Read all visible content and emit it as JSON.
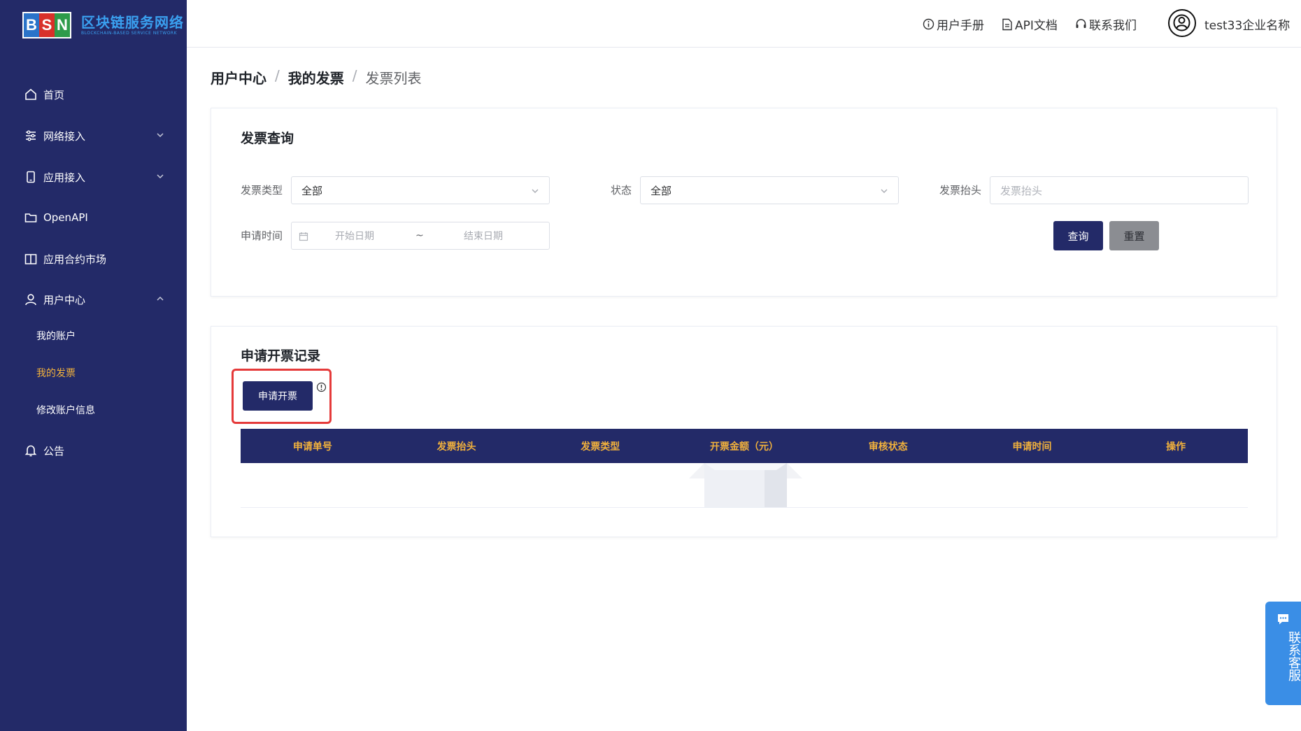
{
  "app": {
    "logo_letters": [
      "B",
      "S",
      "N"
    ],
    "logo_title": "区块链服务网络",
    "logo_subtitle": "BLOCKCHAIN-BASED SERVICE NETWORK"
  },
  "sidebar": {
    "items": [
      {
        "label": "首页",
        "icon": "home-icon"
      },
      {
        "label": "网络接入",
        "icon": "sliders-icon",
        "expandable": true
      },
      {
        "label": "应用接入",
        "icon": "tablet-icon",
        "expandable": true
      },
      {
        "label": "OpenAPI",
        "icon": "folder-icon"
      },
      {
        "label": "应用合约市场",
        "icon": "book-icon"
      },
      {
        "label": "用户中心",
        "icon": "user-icon",
        "expanded": true
      },
      {
        "label": "公告",
        "icon": "bell-icon"
      }
    ],
    "sub_items": [
      {
        "label": "我的账户",
        "active": false
      },
      {
        "label": "我的发票",
        "active": true
      },
      {
        "label": "修改账户信息",
        "active": false
      }
    ]
  },
  "header": {
    "links": [
      "用户手册",
      "API文档",
      "联系我们"
    ],
    "user_name": "test33企业名称"
  },
  "breadcrumb": [
    "用户中心",
    "我的发票",
    "发票列表"
  ],
  "query_card": {
    "title": "发票查询",
    "invoice_type_label": "发票类型",
    "invoice_type_value": "全部",
    "status_label": "状态",
    "status_value": "全部",
    "invoice_title_label": "发票抬头",
    "invoice_title_placeholder": "发票抬头",
    "apply_time_label": "申请时间",
    "start_date_placeholder": "开始日期",
    "range_separator": "~",
    "end_date_placeholder": "结束日期",
    "search_label": "查询",
    "reset_label": "重置"
  },
  "records_card": {
    "title": "申请开票记录",
    "apply_button": "申请开票",
    "columns": [
      "申请单号",
      "发票抬头",
      "发票类型",
      "开票金额（元）",
      "审核状态",
      "申请时间",
      "操作"
    ]
  },
  "float_service": {
    "label": "联系客服"
  },
  "colors": {
    "sidebar_bg": "#232a68",
    "accent_gold": "#f1b13c",
    "highlight_red": "#e53a3a",
    "service_blue": "#3a8ee6"
  }
}
